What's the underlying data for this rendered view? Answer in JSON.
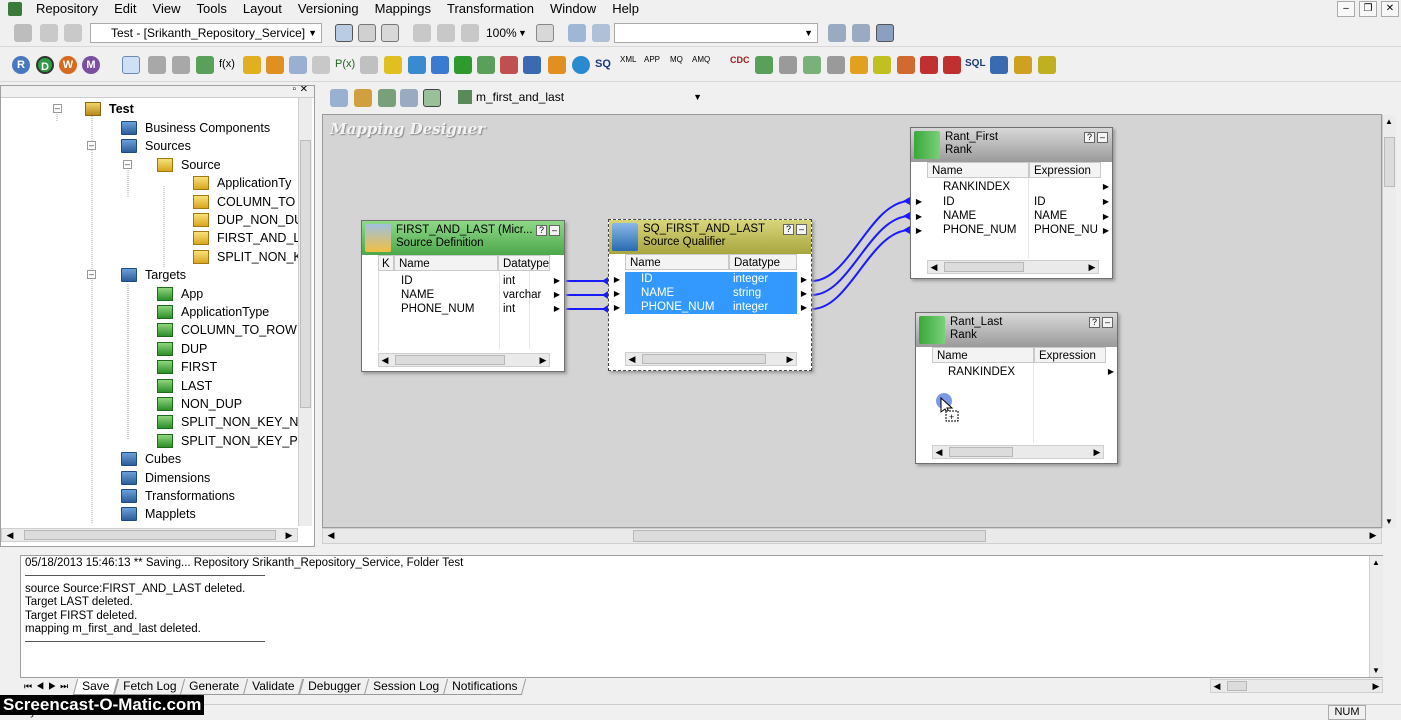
{
  "menu": [
    "Repository",
    "Edit",
    "View",
    "Tools",
    "Layout",
    "Versioning",
    "Mappings",
    "Transformation",
    "Window",
    "Help"
  ],
  "toolbar": {
    "folder_combo": "Test - [Srikanth_Repository_Service]",
    "zoom": "100%",
    "letter_buttons": [
      "R",
      "D",
      "W",
      "M"
    ],
    "icon_labels": [
      "f(x)",
      "P(x)",
      "SQ",
      "XML",
      "APP",
      "MQ",
      "AMQ",
      "CDC",
      "SQL"
    ],
    "mapping_combo": "m_first_and_last"
  },
  "tree": {
    "root": "Test",
    "nodes": [
      {
        "label": "Business Components",
        "level": 1,
        "type": "folder"
      },
      {
        "label": "Sources",
        "level": 1,
        "type": "folder"
      },
      {
        "label": "Source",
        "level": 2,
        "type": "source-db"
      },
      {
        "label": "ApplicationTy",
        "level": 3,
        "type": "source"
      },
      {
        "label": "COLUMN_TO",
        "level": 3,
        "type": "source"
      },
      {
        "label": "DUP_NON_DU",
        "level": 3,
        "type": "source"
      },
      {
        "label": "FIRST_AND_L",
        "level": 3,
        "type": "source"
      },
      {
        "label": "SPLIT_NON_K",
        "level": 3,
        "type": "source"
      },
      {
        "label": "Targets",
        "level": 1,
        "type": "folder"
      },
      {
        "label": "App",
        "level": 2,
        "type": "target"
      },
      {
        "label": "ApplicationType",
        "level": 2,
        "type": "target"
      },
      {
        "label": "COLUMN_TO_ROW",
        "level": 2,
        "type": "target"
      },
      {
        "label": "DUP",
        "level": 2,
        "type": "target"
      },
      {
        "label": "FIRST",
        "level": 2,
        "type": "target"
      },
      {
        "label": "LAST",
        "level": 2,
        "type": "target"
      },
      {
        "label": "NON_DUP",
        "level": 2,
        "type": "target"
      },
      {
        "label": "SPLIT_NON_KEY_NA",
        "level": 2,
        "type": "target"
      },
      {
        "label": "SPLIT_NON_KEY_PH",
        "level": 2,
        "type": "target"
      },
      {
        "label": "Cubes",
        "level": 1,
        "type": "folder"
      },
      {
        "label": "Dimensions",
        "level": 1,
        "type": "folder"
      },
      {
        "label": "Transformations",
        "level": 1,
        "type": "folder"
      },
      {
        "label": "Mapplets",
        "level": 1,
        "type": "folder"
      }
    ]
  },
  "canvas": {
    "title": "Mapping Designer",
    "source_def": {
      "name": "FIRST_AND_LAST (Micr...",
      "subtitle": "Source Definition",
      "key_col": "K",
      "col_name": "Name",
      "col_type": "Datatype",
      "rows": [
        {
          "name": "ID",
          "type": "int"
        },
        {
          "name": "NAME",
          "type": "varchar"
        },
        {
          "name": "PHONE_NUM",
          "type": "int"
        }
      ]
    },
    "source_qualifier": {
      "name": "SQ_FIRST_AND_LAST",
      "subtitle": "Source Qualifier",
      "col_name": "Name",
      "col_type": "Datatype",
      "rows": [
        {
          "name": "ID",
          "type": "integer"
        },
        {
          "name": "NAME",
          "type": "string"
        },
        {
          "name": "PHONE_NUM",
          "type": "integer"
        }
      ]
    },
    "rank_first": {
      "name": "Rant_First",
      "subtitle": "Rank",
      "col_name": "Name",
      "col_expr": "Expression",
      "rows": [
        {
          "name": "RANKINDEX",
          "expr": ""
        },
        {
          "name": "ID",
          "expr": "ID"
        },
        {
          "name": "NAME",
          "expr": "NAME"
        },
        {
          "name": "PHONE_NUM",
          "expr": "PHONE_NU"
        }
      ]
    },
    "rank_last": {
      "name": "Rant_Last",
      "subtitle": "Rank",
      "col_name": "Name",
      "col_expr": "Expression",
      "rows": [
        {
          "name": "RANKINDEX",
          "expr": ""
        }
      ]
    }
  },
  "output": {
    "lines": [
      "05/18/2013 15:46:13 ** Saving... Repository Srikanth_Repository_Service, Folder Test",
      "source Source:FIRST_AND_LAST deleted.",
      "Target LAST deleted.",
      "Target FIRST deleted.",
      "mapping  m_first_and_last deleted."
    ],
    "tabs": [
      "Save",
      "Fetch Log",
      "Generate",
      "Validate",
      "Debugger",
      "Session Log",
      "Notifications"
    ],
    "active_tab": "Save"
  },
  "status": {
    "left": "Ready",
    "num": "NUM"
  },
  "watermark": "Screencast-O-Matic.com",
  "colors": {
    "source_header": "#6fc46a",
    "sq_header": "#b6b44a",
    "rank_header": "#a8a8a8",
    "selection": "#3399ff",
    "link": "#1a1aff"
  }
}
